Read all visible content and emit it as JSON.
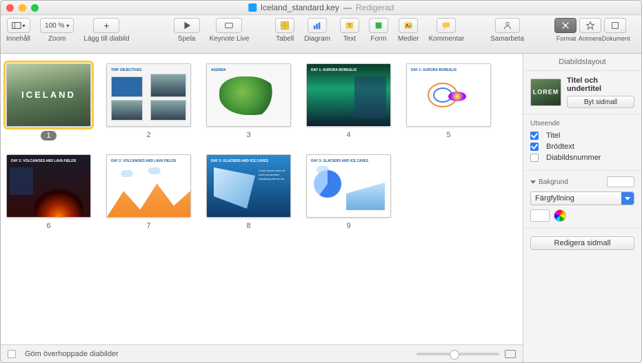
{
  "window": {
    "filename": "Iceland_standard.key",
    "status": "Redigerad"
  },
  "toolbar": {
    "view_label": "Innehåll",
    "zoom_value": "100 %",
    "zoom_label": "Zoom",
    "add_slide_label": "Lägg till diabild",
    "play_label": "Spela",
    "keynote_live_label": "Keynote Live",
    "table_label": "Tabell",
    "chart_label": "Diagram",
    "text_label": "Text",
    "shape_label": "Form",
    "media_label": "Medier",
    "comment_label": "Kommentar",
    "collaborate_label": "Samarbeta",
    "format_label": "Format",
    "animate_label": "Animera",
    "document_label": "Dokument"
  },
  "slides": [
    {
      "num": "1",
      "title": "ICELAND",
      "selected": true
    },
    {
      "num": "2",
      "title": "TRIP OBJECTIVES"
    },
    {
      "num": "3",
      "title": "AGENDA"
    },
    {
      "num": "4",
      "title": "DAY 1: AURORA BOREALIS"
    },
    {
      "num": "5",
      "title": "DAY 1: AURORA BOREALIS"
    },
    {
      "num": "6",
      "title": "DAY 2: VOLCANOES AND LAVA FIELDS"
    },
    {
      "num": "7",
      "title": "DAY 2: VOLCANOES AND LAVA FIELDS"
    },
    {
      "num": "8",
      "title": "DAY 3: GLACIERS AND ICE CAVES"
    },
    {
      "num": "9",
      "title": "DAY 3: GLACIERS AND ICE CAVES"
    }
  ],
  "bottombar": {
    "hide_skipped_label": "Göm överhoppade diabilder"
  },
  "inspector": {
    "header": "Diabildslayout",
    "layout_title": "Titel och undertitel",
    "change_master_label": "Byt sidmall",
    "appearance_label": "Utseende",
    "opt_title": "Titel",
    "opt_body": "Brödtext",
    "opt_slidenum": "Diabildsnummer",
    "background_label": "Bakgrund",
    "fill_type": "Färgfyllning",
    "edit_master_label": "Redigera sidmall"
  }
}
